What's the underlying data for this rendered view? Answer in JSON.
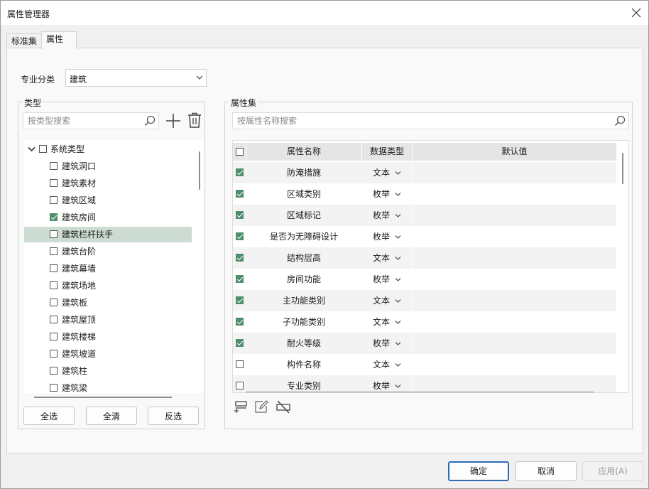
{
  "window": {
    "title": "属性管理器"
  },
  "tabs": [
    {
      "label": "标准集",
      "active": false
    },
    {
      "label": "属性",
      "active": true
    }
  ],
  "specialty": {
    "label": "专业分类",
    "value": "建筑"
  },
  "type_panel": {
    "title": "类型",
    "search_placeholder": "按类型搜索",
    "root": {
      "label": "系统类型",
      "expanded": true,
      "checked": false
    },
    "items": [
      {
        "label": "建筑洞口",
        "checked": false,
        "selected": false
      },
      {
        "label": "建筑素材",
        "checked": false,
        "selected": false
      },
      {
        "label": "建筑区域",
        "checked": false,
        "selected": false
      },
      {
        "label": "建筑房间",
        "checked": true,
        "selected": false
      },
      {
        "label": "建筑栏杆扶手",
        "checked": false,
        "selected": true
      },
      {
        "label": "建筑台阶",
        "checked": false,
        "selected": false
      },
      {
        "label": "建筑幕墙",
        "checked": false,
        "selected": false
      },
      {
        "label": "建筑场地",
        "checked": false,
        "selected": false
      },
      {
        "label": "建筑板",
        "checked": false,
        "selected": false
      },
      {
        "label": "建筑屋顶",
        "checked": false,
        "selected": false
      },
      {
        "label": "建筑楼梯",
        "checked": false,
        "selected": false
      },
      {
        "label": "建筑坡道",
        "checked": false,
        "selected": false
      },
      {
        "label": "建筑柱",
        "checked": false,
        "selected": false
      },
      {
        "label": "建筑梁",
        "checked": false,
        "selected": false
      }
    ],
    "buttons": {
      "select_all": "全选",
      "clear_all": "全清",
      "invert": "反选"
    }
  },
  "attr_panel": {
    "title": "属性集",
    "search_placeholder": "按属性名称搜索",
    "columns": {
      "name": "属性名称",
      "type": "数据类型",
      "default": "默认值"
    },
    "rows": [
      {
        "checked": true,
        "name": "防淹措施",
        "type": "文本",
        "default": ""
      },
      {
        "checked": true,
        "name": "区域类别",
        "type": "枚举",
        "default": ""
      },
      {
        "checked": true,
        "name": "区域标记",
        "type": "枚举",
        "default": ""
      },
      {
        "checked": true,
        "name": "是否为无障碍设计",
        "type": "枚举",
        "default": ""
      },
      {
        "checked": true,
        "name": "结构层高",
        "type": "文本",
        "default": ""
      },
      {
        "checked": true,
        "name": "房间功能",
        "type": "枚举",
        "default": ""
      },
      {
        "checked": true,
        "name": "主功能类别",
        "type": "文本",
        "default": ""
      },
      {
        "checked": true,
        "name": "子功能类别",
        "type": "文本",
        "default": ""
      },
      {
        "checked": true,
        "name": "耐火等级",
        "type": "枚举",
        "default": ""
      },
      {
        "checked": false,
        "name": "构件名称",
        "type": "文本",
        "default": ""
      },
      {
        "checked": false,
        "name": "专业类别",
        "type": "枚举",
        "default": ""
      }
    ]
  },
  "footer": {
    "ok": "确定",
    "cancel": "取消",
    "apply": "应用(A)"
  },
  "colors": {
    "accent": "#2d6bb5",
    "check": "#4c8f6a",
    "selection": "#ccdcd3"
  }
}
